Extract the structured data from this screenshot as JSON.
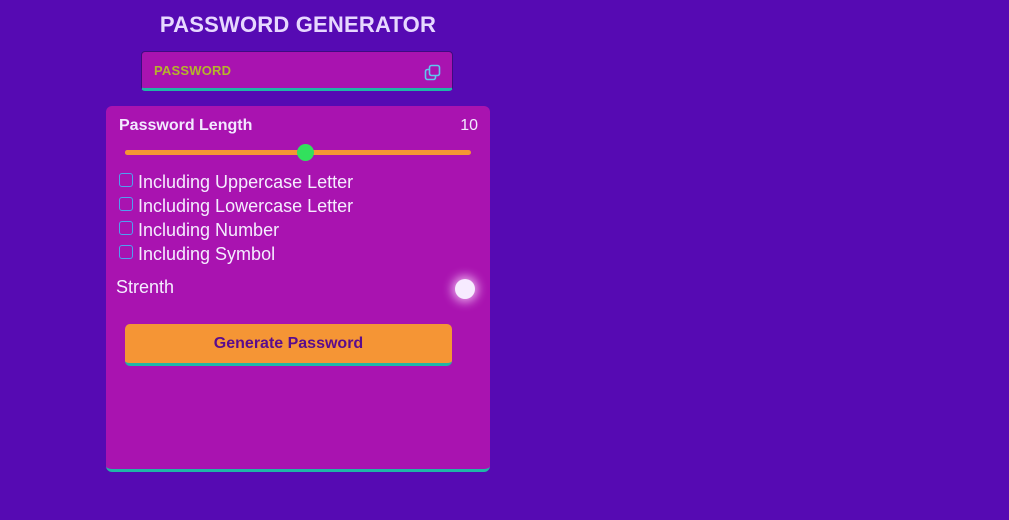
{
  "header": {
    "title": "PASSWORD GENERATOR"
  },
  "password_display": {
    "text": "PASSWORD",
    "copy_icon": "copy-icon"
  },
  "length": {
    "label": "Password Length",
    "value": "10",
    "slider_fraction": 0.52
  },
  "options": [
    {
      "label": "Including Uppercase Letter",
      "checked": false
    },
    {
      "label": "Including Lowercase Letter",
      "checked": false
    },
    {
      "label": "Including Number",
      "checked": false
    },
    {
      "label": "Including Symbol",
      "checked": false
    }
  ],
  "strength": {
    "label": "Strenth",
    "indicator_color": "#f7ebff"
  },
  "generate": {
    "label": "Generate Password"
  },
  "colors": {
    "background": "#560ab3",
    "card": "#a913b0",
    "accent_orange": "#f59534",
    "slider_thumb": "#32e05d",
    "border_teal": "#1fb6a7",
    "password_text": "#b6b42c"
  }
}
